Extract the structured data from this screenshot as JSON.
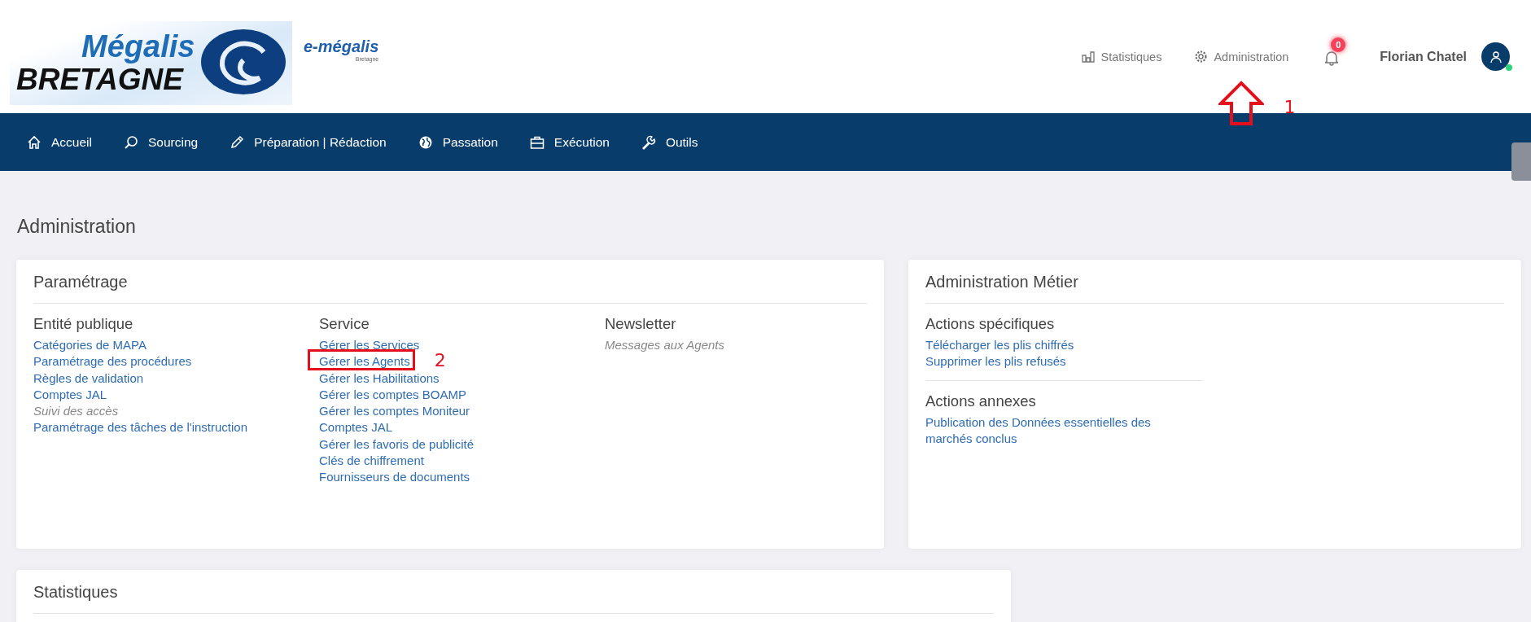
{
  "logo": {
    "title": "Mégalis",
    "subtitle": "BRETAGNE",
    "badge_title": "e-mégalis",
    "badge_subtitle": "Bretagne"
  },
  "top_links": [
    {
      "kind": "stats",
      "label": "Statistiques"
    },
    {
      "kind": "admin",
      "label": "Administration",
      "annotation": "1"
    }
  ],
  "notifications": {
    "count": "0"
  },
  "user": {
    "name": "Florian Chatel",
    "online": true
  },
  "nav": [
    {
      "label": "Accueil"
    },
    {
      "label": "Sourcing"
    },
    {
      "label": "Préparation | Rédaction"
    },
    {
      "label": "Passation"
    },
    {
      "label": "Exécution"
    },
    {
      "label": "Outils"
    }
  ],
  "page_title": "Administration",
  "parametrage": {
    "title": "Paramétrage",
    "columns": [
      {
        "heading": "Entité publique",
        "links": [
          {
            "label": "Catégories de MAPA",
            "disabled": false
          },
          {
            "label": "Paramétrage des procédures",
            "disabled": false
          },
          {
            "label": "Règles de validation",
            "disabled": false
          },
          {
            "label": "Comptes JAL",
            "disabled": false
          },
          {
            "label": "Suivi des accès",
            "disabled": true
          },
          {
            "label": "Paramétrage des tâches de l'instruction",
            "disabled": false
          }
        ]
      },
      {
        "heading": "Service",
        "links": [
          {
            "label": "Gérer les Services",
            "disabled": false
          },
          {
            "label": "Gérer les Agents",
            "disabled": false,
            "annotation": "2"
          },
          {
            "label": "Gérer les Habilitations",
            "disabled": false
          },
          {
            "label": "Gérer les comptes BOAMP",
            "disabled": false
          },
          {
            "label": "Gérer les comptes Moniteur",
            "disabled": false
          },
          {
            "label": "Comptes JAL",
            "disabled": false
          },
          {
            "label": "Gérer les favoris de publicité",
            "disabled": false
          },
          {
            "label": "Clés de chiffrement",
            "disabled": false
          },
          {
            "label": "Fournisseurs de documents",
            "disabled": false
          }
        ]
      },
      {
        "heading": "Newsletter",
        "links": [
          {
            "label": "Messages aux Agents",
            "disabled": true
          }
        ]
      }
    ]
  },
  "admin_metier": {
    "title": "Administration Métier",
    "sections": [
      {
        "heading": "Actions spécifiques",
        "links": [
          {
            "label": "Télécharger les plis chiffrés",
            "disabled": false
          },
          {
            "label": "Supprimer les plis refusés",
            "disabled": false
          }
        ]
      },
      {
        "heading": "Actions annexes",
        "links": [
          {
            "label": "Publication des Données essentielles des marchés conclus",
            "disabled": false
          }
        ]
      }
    ]
  },
  "statistiques": {
    "title": "Statistiques"
  }
}
